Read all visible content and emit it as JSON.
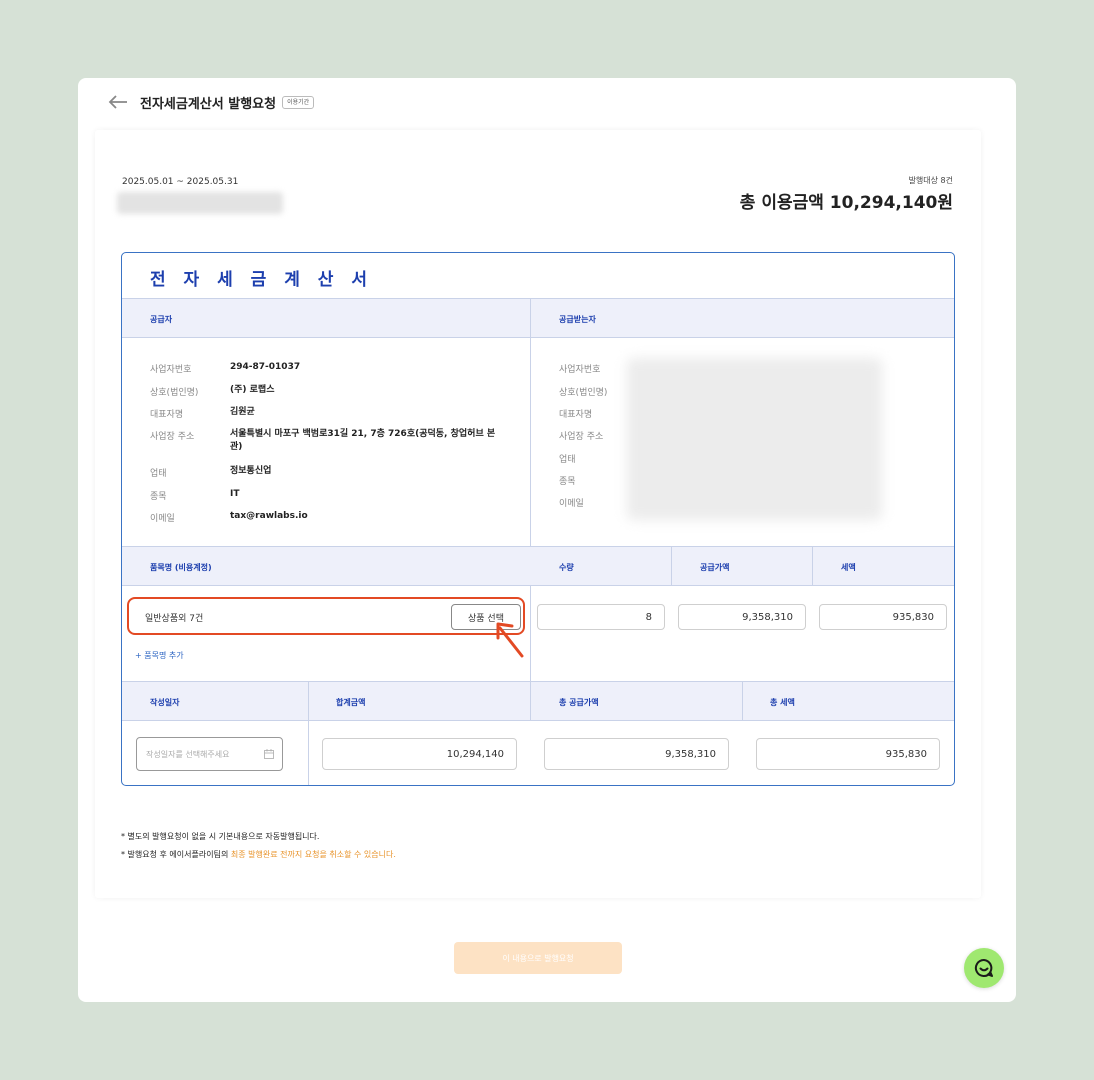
{
  "header": {
    "title": "전자세금계산서 발행요청",
    "badge": "이용기간"
  },
  "summary": {
    "date_range": "2025.05.01 ~ 2025.05.31",
    "target_count": "발행대상 8건",
    "total_amount": "총 이용금액 10,294,140원"
  },
  "invoice": {
    "title": "전 자 세 금 계 산 서",
    "supplier_header": "공급자",
    "receiver_header": "공급받는자",
    "supplier": {
      "labels": [
        "사업자번호",
        "상호(법인명)",
        "대표자명",
        "사업장 주소",
        "업태",
        "종목",
        "이메일"
      ],
      "values": [
        "294-87-01037",
        "(주) 로랩스",
        "김원균",
        "서울특별시 마포구 백범로31길 21, 7층 726호(공덕동, 창업허브 본관)",
        "정보통신업",
        "IT",
        "tax@rawlabs.io"
      ]
    },
    "receiver": {
      "labels": [
        "사업자번호",
        "상호(법인명)",
        "대표자명",
        "사업장 주소",
        "업태",
        "종목",
        "이메일"
      ]
    },
    "item_headers": {
      "name": "품목명 (비용계정)",
      "qty": "수량",
      "supply": "공급가액",
      "tax": "세액"
    },
    "item": {
      "name": "일반상품외 7건",
      "button": "상품 선택",
      "qty": "8",
      "supply": "9,358,310",
      "tax": "935,830"
    },
    "add_item": "+ 품목명 추가",
    "total_headers": {
      "date": "작성일자",
      "sum": "합계금액",
      "supply": "총 공급가액",
      "tax": "총 세액"
    },
    "totals": {
      "date_placeholder": "작성일자를 선택해주세요",
      "sum": "10,294,140",
      "supply": "9,358,310",
      "tax": "935,830"
    }
  },
  "notes": {
    "line1": "* 별도의 발행요청이 없을 시 기본내용으로 자동발행됩니다.",
    "line2_prefix": "* 발행요청 후 에이서플라이팀의 ",
    "line2_highlight": "최종 발행완료 전까지 요청을 취소할 수 있습니다."
  },
  "submit_label": "이 내용으로 발행요청",
  "colors": {
    "accent": "#1d3fae",
    "highlight": "#e34a24",
    "submit": "#fde2c4",
    "chat": "#9fe870"
  }
}
